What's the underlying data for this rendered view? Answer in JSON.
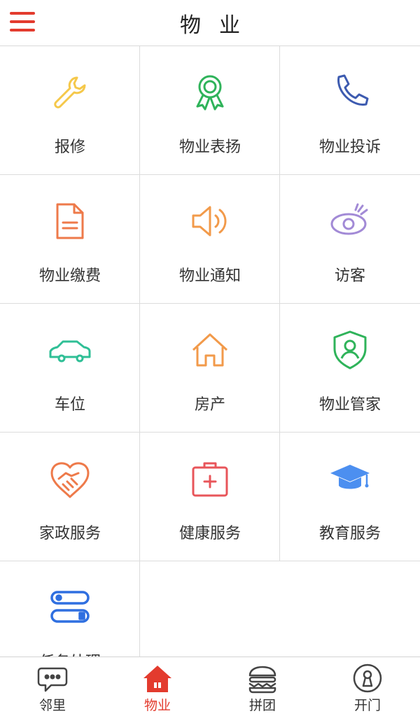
{
  "header": {
    "title": "物业",
    "menu_icon": "menu-icon"
  },
  "colors": {
    "accent": "#e33b2e",
    "yellow": "#f5c84a",
    "green": "#2fb35a",
    "blue": "#3d5bb0",
    "orange": "#ee7a4a",
    "orange2": "#f29a4a",
    "purple": "#a28ad6",
    "teal": "#2fbf96",
    "lightblue": "#4c8ff0"
  },
  "grid": {
    "items": [
      {
        "label": "报修",
        "icon": "wrench-icon"
      },
      {
        "label": "物业表扬",
        "icon": "award-ribbon-icon"
      },
      {
        "label": "物业投诉",
        "icon": "phone-icon"
      },
      {
        "label": "物业缴费",
        "icon": "document-icon"
      },
      {
        "label": "物业通知",
        "icon": "speaker-icon"
      },
      {
        "label": "访客",
        "icon": "eye-icon"
      },
      {
        "label": "车位",
        "icon": "car-icon"
      },
      {
        "label": "房产",
        "icon": "house-icon"
      },
      {
        "label": "物业管家",
        "icon": "shield-user-icon"
      },
      {
        "label": "家政服务",
        "icon": "heart-handshake-icon"
      },
      {
        "label": "健康服务",
        "icon": "medical-kit-icon"
      },
      {
        "label": "教育服务",
        "icon": "graduation-cap-icon"
      },
      {
        "label": "任务处理",
        "icon": "toggle-list-icon"
      }
    ]
  },
  "tabbar": {
    "tabs": [
      {
        "label": "邻里",
        "icon": "chat-bubble-icon",
        "active": false
      },
      {
        "label": "物业",
        "icon": "home-icon",
        "active": true
      },
      {
        "label": "拼团",
        "icon": "burger-icon",
        "active": false
      },
      {
        "label": "开门",
        "icon": "keyhole-icon",
        "active": false
      }
    ]
  }
}
